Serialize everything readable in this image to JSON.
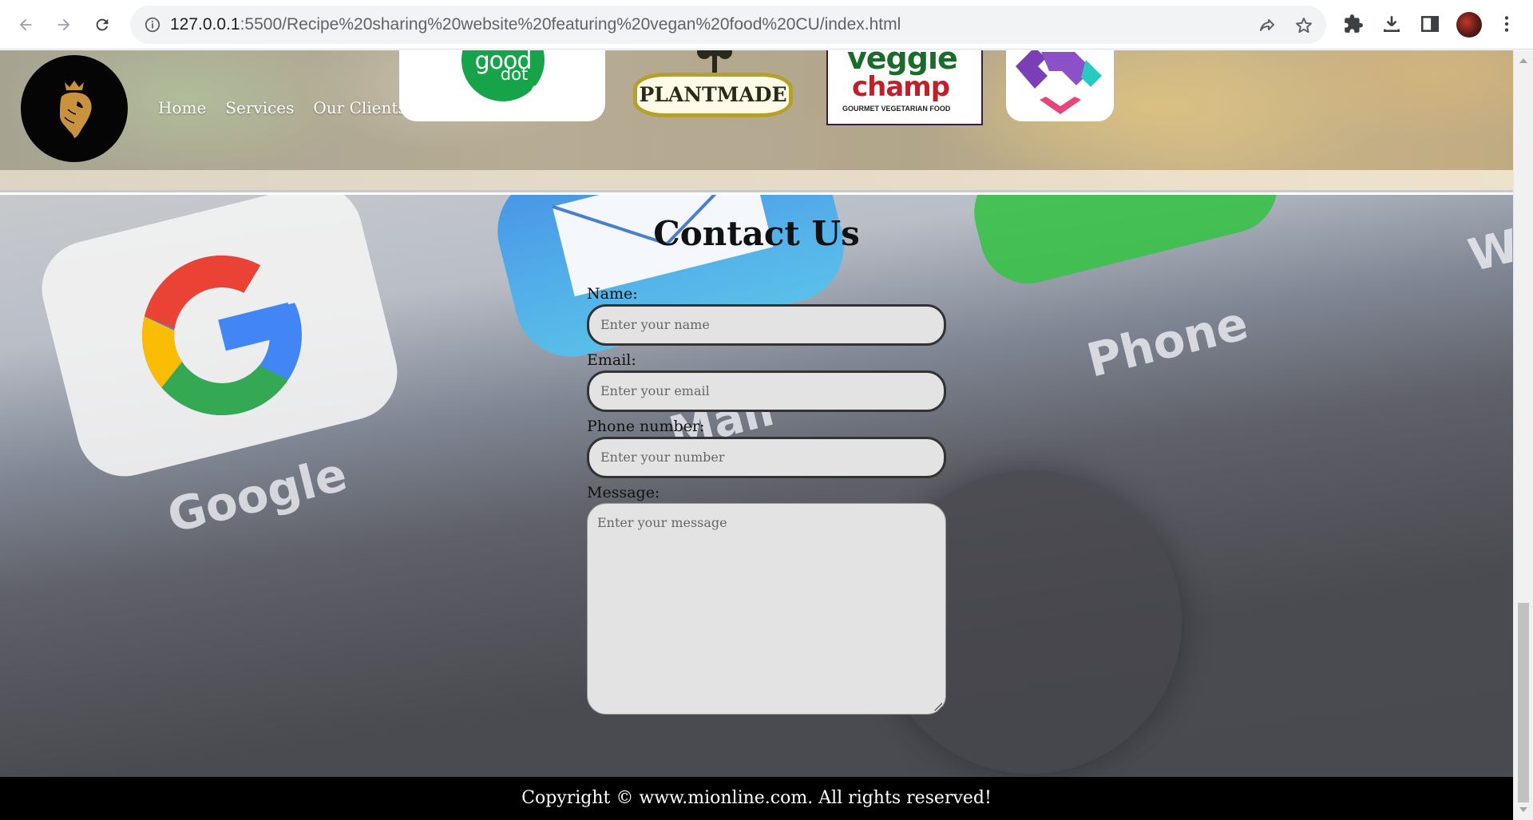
{
  "browser": {
    "url_host": "127.0.0.1",
    "url_path": ":5500/Recipe%20sharing%20website%20featuring%20vegan%20food%20CU/index.html"
  },
  "header": {
    "nav": [
      "Home",
      "Services",
      "Our Clients"
    ],
    "clients": {
      "gooddot_line1": "good",
      "gooddot_line2": "dot",
      "plantmade": "PLANTMADE",
      "veggie_line1": "veggie",
      "veggie_line2": "champ",
      "veggie_tagline": "GOURMET VEGETARIAN FOOD"
    }
  },
  "background": {
    "google_label": "Google",
    "mail_label": "Mail",
    "phone_label": "Phone",
    "partial_label": "W"
  },
  "contact": {
    "title": "Contact Us",
    "name_label": "Name:",
    "name_placeholder": "Enter your name",
    "email_label": "Email:",
    "email_placeholder": "Enter your email",
    "phone_label": "Phone number:",
    "phone_placeholder": "Enter your number",
    "message_label": "Message:",
    "message_placeholder": "Enter your message"
  },
  "footer": {
    "copyright": "Copyright © www.mionline.com. All rights reserved!"
  },
  "colors": {
    "footer_bg": "#000000",
    "gooddot_green": "#17a34a",
    "veggie_green": "#1b6b2b",
    "veggie_red": "#c0202a",
    "plantmade_gold": "#b3a12b",
    "logo_gold": "#c9923f"
  }
}
